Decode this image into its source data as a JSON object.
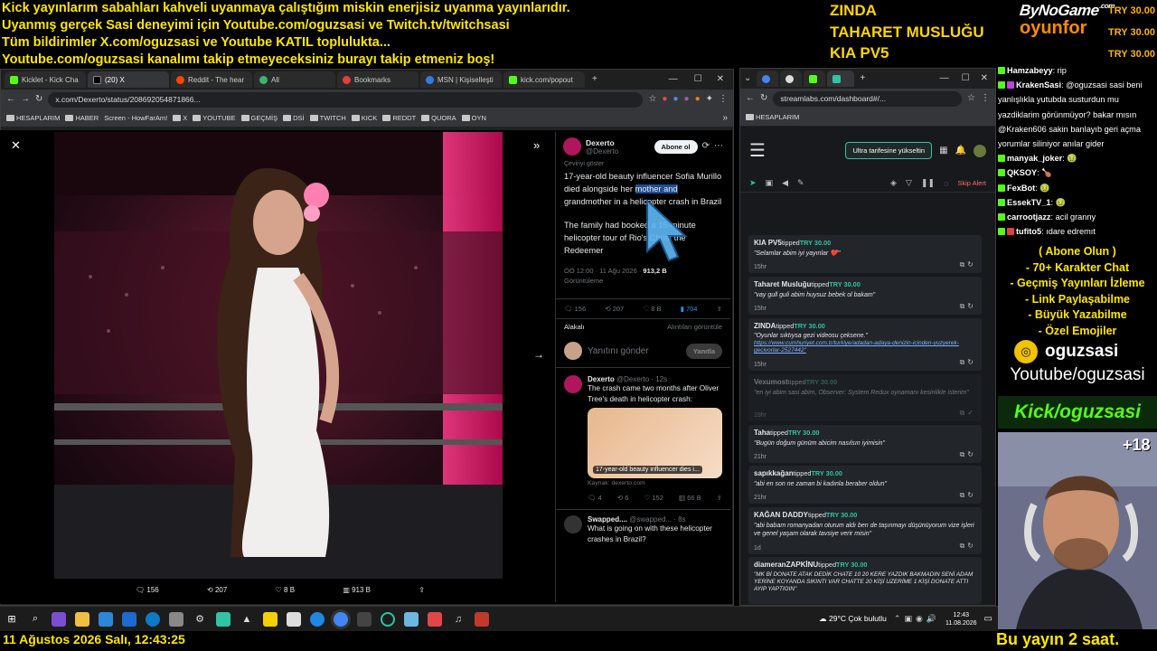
{
  "overlay": {
    "lines": [
      "Kick yayınlarım sabahları kahveli uyanmaya çalıştığım miskin enerjisiz uyanma yayınlarıdır.",
      "Uyanmış gerçek Sasi deneyimi için Youtube.com/oguzsasi ve Twitch.tv/twitchsasi",
      "Tüm bildirimler X.com/oguzsasi ve Youtube KATIL toplulukta...",
      "Youtube.com/oguzsasi kanalımı takip etmeyeceksiniz burayı takip etmeniz boş!"
    ],
    "tip_lines": [
      "ZINDA",
      "TAHARET MUSLUĞU",
      "KIA PV5"
    ],
    "brand_top": "ByNoGame",
    "brand_sub": ".com",
    "brand_bottom": "oyunfor",
    "donations": [
      "TRY 30.00",
      "TRY 30.00",
      "TRY 30.00"
    ],
    "bottom_date": "11 Ağustos 2026 Salı, 12:43:25",
    "bottom_right": "Bu yayın 2 saat."
  },
  "left_browser": {
    "tabs": [
      "Kicklet - Kick Cha",
      "(20) X",
      "Reddit - The hear",
      "All",
      "Bookmarks",
      "MSN | Kişiselleşti",
      "kick.com/popout"
    ],
    "url": "x.com/Dexerto/status/208692054871866...",
    "bookmarks": [
      "HESAPLARIM",
      "HABER",
      "Screen - HowFarAm!",
      "X",
      "YOUTUBE",
      "GEÇMİŞ",
      "DSİ",
      "TWITCH",
      "KICK",
      "REDDT",
      "QUORA",
      "OYN"
    ]
  },
  "tweet": {
    "author": "Dexerto",
    "handle": "@Dexerto",
    "follow_label": "Abone ol",
    "translate": "Çeviriyi göster",
    "text_before": "17-year-old beauty influencer Sofia Murillo died alongside her ",
    "text_highlight": "mother and",
    "text_after": " grandmother in a helicopter crash in Brazil",
    "text2": "The family had booked a 15-minute helicopter tour of Rio's Christ the Redeemer",
    "time": "ÖÖ 12:00 · 11 Ağu 2026 · ",
    "views": "913,2 B",
    "views_label": "Görüntüleme",
    "replies": "156",
    "retweets": "207",
    "likes": "8 B",
    "bookmarks": "704",
    "related": "Alakalı",
    "quotes": "Alıntıları görüntüle",
    "reply_placeholder": "Yanıtını gönder",
    "reply_button": "Yanıtla",
    "photo_stats": [
      "156",
      "207",
      "8 B",
      "913 B"
    ]
  },
  "reply1": {
    "author": "Dexerto",
    "meta": "@Dexerto · 12s",
    "text": "The crash came two months after Oliver Tree's death in helicopter crash:",
    "card_caption": "17-year-old beauty influencer dies i...",
    "source": "Kaynak: dexerto.com",
    "stats": [
      "4",
      "6",
      "152",
      "66 B"
    ]
  },
  "reply2": {
    "author": "Swapped....",
    "meta": "@swapped... · 8s",
    "text": "What is going on with these helicopter crashes in Brazil?"
  },
  "streamlabs": {
    "url": "streamlabs.com/dashboard#/...",
    "bookmark": "HESAPLARIM",
    "upgrade": "Ultra tarifesine yükseltin",
    "skip": "Skip Alert",
    "items": [
      {
        "name": "KIA PV5",
        "tipped": "tipped",
        "amount": "TRY 30.00",
        "msg": "\"Selamlar abim iyi yayınlar ❤️\"",
        "ago": "15hr"
      },
      {
        "name": "Taharet Musluğu",
        "tipped": "tipped",
        "amount": "TRY 30.00",
        "msg": "\"vay gull guli abim huysuz bebek ol bakam\"",
        "ago": "15hr"
      },
      {
        "name": "ZINDA",
        "tipped": "tipped",
        "amount": "TRY 30.00",
        "msg": "\"Oyunlar sıktıysa gezi videosu çeksene.\"",
        "link": "https://www.cumhuriyet.com.tr/turkiye/adadan-adaya-denizin-icinden-yuzyerek-gecivorlar-2527442\"",
        "ago": "15hr"
      },
      {
        "name": "Vexumost",
        "tipped": "tipped",
        "amount": "TRY 30.00",
        "msg": "\"en iyi abim sasi abim, Observer: System Redux oynamanı kesinlikle isterim\"",
        "ago": "19hr"
      },
      {
        "name": "Taha",
        "tipped": "tipped",
        "amount": "TRY 30.00",
        "msg": "\"Bugün doğum günüm abicim nasılsın iyimisin\"",
        "ago": "21hr"
      },
      {
        "name": "sapıkkağan",
        "tipped": "tipped",
        "amount": "TRY 30.00",
        "msg": "\"abi en son ne zaman bi kadınla beraber oldun\"",
        "ago": "21hr"
      },
      {
        "name": "KAĞAN DADDY",
        "tipped": "tipped",
        "amount": "TRY 30.00",
        "msg": "\"abi babam romanyadan oturum aldı ben de taşınmayı düşünüyorum vize işleri ve genel yaşam olarak tavsiye verir misin\"",
        "ago": "1d"
      },
      {
        "name": "diameranZAPKİNU",
        "tipped": "tipped",
        "amount": "TRY 30.00",
        "msg": "\"MK Bİ DONATE ATAK DEDİK CHATE 10 20 KERE YAZDIK BAKMADIN SENİ ADAM YERİNE KOYANDA SIKINTI VAR CHATTE 20 KİŞİ UZERİME 1 KİŞİ DONATE ATTI AYIP YAPTIGIN\"",
        "ago": "1d"
      }
    ]
  },
  "chat": [
    {
      "user": "Hamzabeyy",
      "text": "rip"
    },
    {
      "user": "KrakenSasi",
      "text": "@oguzsasi sasi beni"
    },
    {
      "user": "",
      "text": "yanlışlıkla yutubda susturdun mu"
    },
    {
      "user": "",
      "text": "yazdiklarim görünmüyor? bakar mısın"
    },
    {
      "user": "",
      "text": "@Kraken606 sakin banlayıb geri açma"
    },
    {
      "user": "",
      "text": "yorumlar siliniyor anılar gider"
    },
    {
      "user": "manyak_joker",
      "text": "🤢"
    },
    {
      "user": "QKSOY",
      "text": "🍗"
    },
    {
      "user": "FexBot",
      "text": "🤢"
    },
    {
      "user": "EssekTV_1",
      "text": "🤢"
    },
    {
      "user": "carrootjazz",
      "text": "acil granny"
    },
    {
      "user": "tufito5",
      "text": "ıdare edremıt"
    }
  ],
  "promo": [
    "( Abone Olun )",
    "- 70+ Karakter Chat",
    "- Geçmiş Yayınları İzleme",
    "- Link Paylaşabilme",
    "- Büyük Yazabilme",
    "- Özel Emojiler"
  ],
  "promo_handle": "oguzsasi",
  "youtube_label": "Youtube/oguzsasi",
  "kick_label": "Kick/oguzsasi",
  "age_badge": "+18",
  "tray": {
    "weather": "29°C Çok bulutlu",
    "time": "12:43",
    "date": "11.08.2026"
  }
}
